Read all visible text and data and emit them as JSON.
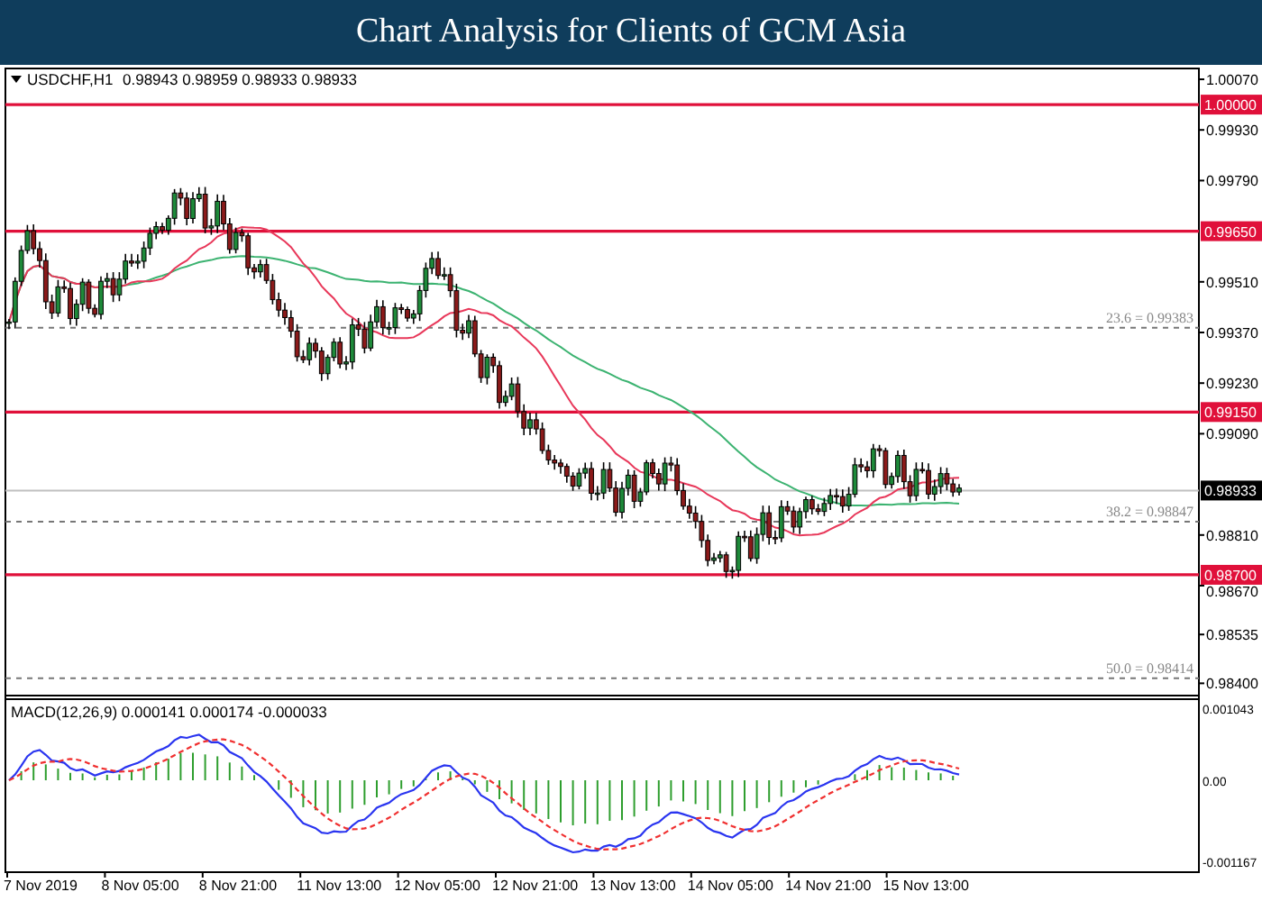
{
  "header": {
    "title": "Chart Analysis for Clients of GCM Asia"
  },
  "chart": {
    "symbol": "USDCHF,H1",
    "ohlc": "0.98943 0.98959 0.98933 0.98933",
    "price_ticks": [
      "1.00070",
      "0.99930",
      "0.99790",
      "0.99510",
      "0.99370",
      "0.99230",
      "0.99090",
      "0.98810",
      "0.98670",
      "0.98535",
      "0.98400"
    ],
    "levels": [
      {
        "kind": "line",
        "label": "1.00000"
      },
      {
        "kind": "line",
        "label": "0.99650"
      },
      {
        "kind": "fibonacci",
        "label": "23.6 = 0.99383"
      },
      {
        "kind": "line",
        "label": "0.99150"
      },
      {
        "kind": "current",
        "label": "0.98933"
      },
      {
        "kind": "fibonacci",
        "label": "38.2 = 0.98847"
      },
      {
        "kind": "line",
        "label": "0.98700"
      },
      {
        "kind": "fibonacci",
        "label": "50.0 = 0.98414"
      }
    ],
    "indicator": {
      "label": "MACD(12,26,9) 0.000141 0.000174 -0.000033",
      "ticks": [
        "0.001043",
        "0.00",
        "-0.001167"
      ]
    },
    "time_axis": [
      "7 Nov 2019",
      "8 Nov 05:00",
      "8 Nov 21:00",
      "11 Nov 13:00",
      "12 Nov 05:00",
      "12 Nov 21:00",
      "13 Nov 13:00",
      "14 Nov 05:00",
      "14 Nov 21:00",
      "15 Nov 13:00"
    ]
  }
}
